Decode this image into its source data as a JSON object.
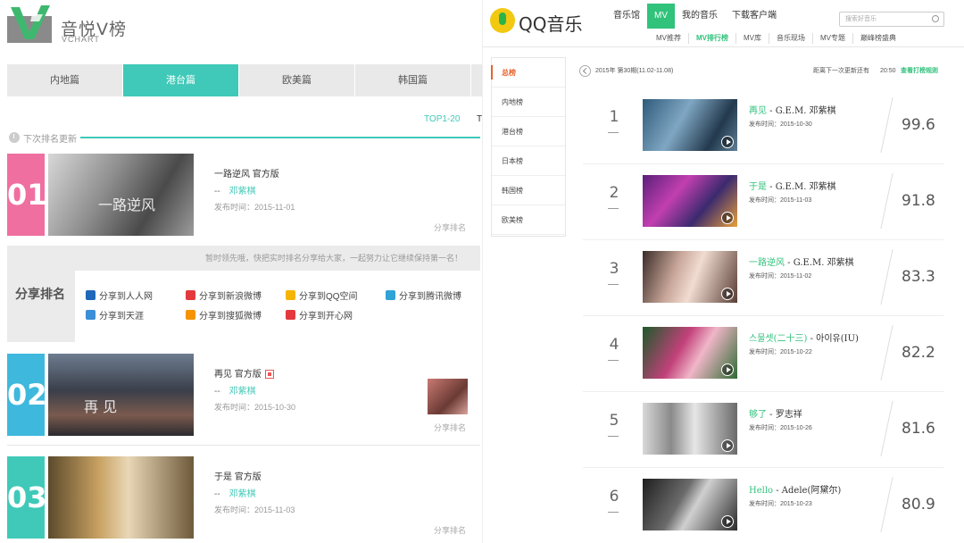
{
  "yinyue": {
    "brand": "音悦V榜",
    "brand_sub": "VCHART",
    "region_tabs": [
      {
        "label": "内地篇",
        "active": false
      },
      {
        "label": "港台篇",
        "active": true
      },
      {
        "label": "欧美篇",
        "active": false
      },
      {
        "label": "韩国篇",
        "active": false
      }
    ],
    "range_active": "TOP1-20",
    "range_other": "T",
    "next_update": "下次排名更新",
    "rows": [
      {
        "rank": "01",
        "color": "#ef6fa0",
        "thumb_text": "一路逆风",
        "title": "一路逆风 官方版",
        "dash": "--",
        "artist": "邓紫棋",
        "date": "发布时间：2015-11-01",
        "share": "分享排名"
      },
      {
        "rank": "02",
        "color": "#3fb8dd",
        "thumb_text": "再  见",
        "title": "再见 官方版",
        "dash": "--",
        "artist": "邓紫棋",
        "date": "发布时间：2015-10-30",
        "share": "分享排名"
      },
      {
        "rank": "03",
        "color": "#40c9b8",
        "thumb_text": "",
        "title": "于是 官方版",
        "dash": "--",
        "artist": "邓紫棋",
        "date": "发布时间：2015-11-03",
        "share": "分享排名"
      }
    ],
    "share_panel": {
      "label": "分享排名",
      "message": "暂时领先哦，快把实时排名分享给大家，一起努力让它继续保持第一名！",
      "items": [
        {
          "label": "分享到人人网",
          "color": "#1f67b8"
        },
        {
          "label": "分享到新浪微博",
          "color": "#e4393c"
        },
        {
          "label": "分享到QQ空间",
          "color": "#f5b400"
        },
        {
          "label": "分享到腾讯微博",
          "color": "#2fa2d6"
        },
        {
          "label": "分享到天涯",
          "color": "#3a8fd6"
        },
        {
          "label": "分享到搜狐微博",
          "color": "#f59300"
        },
        {
          "label": "分享到开心网",
          "color": "#e4393c"
        }
      ]
    }
  },
  "qq": {
    "brand": "QQ音乐",
    "nav": [
      {
        "label": "音乐馆",
        "active": false
      },
      {
        "label": "MV",
        "active": true
      },
      {
        "label": "我的音乐",
        "active": false
      },
      {
        "label": "下载客户端",
        "active": false
      }
    ],
    "search_placeholder": "搜索好音乐",
    "subnav": [
      {
        "label": "MV推荐",
        "active": false
      },
      {
        "label": "MV排行榜",
        "active": true
      },
      {
        "label": "MV库",
        "active": false
      },
      {
        "label": "音乐现场",
        "active": false
      },
      {
        "label": "MV专题",
        "active": false
      },
      {
        "label": "巅峰榜盛典",
        "active": false
      }
    ],
    "side_tabs": [
      {
        "label": "总榜",
        "active": true
      },
      {
        "label": "内地榜",
        "active": false
      },
      {
        "label": "港台榜",
        "active": false
      },
      {
        "label": "日本榜",
        "active": false
      },
      {
        "label": "韩国榜",
        "active": false
      },
      {
        "label": "欧美榜",
        "active": false
      }
    ],
    "period": "2015年 第30期(11.02-11.08)",
    "next_update_label": "距离下一次更新还有",
    "next_update_time": "20:50",
    "rules_link": "查看打榜规则",
    "rows": [
      {
        "rank": "1",
        "song": "再见",
        "artist": " - G.E.M. 邓紫棋",
        "date": "发布时间：2015-10-30",
        "score": "99.6"
      },
      {
        "rank": "2",
        "song": "于是",
        "artist": " - G.E.M. 邓紫棋",
        "date": "发布时间：2015-11-03",
        "score": "91.8"
      },
      {
        "rank": "3",
        "song": "一路逆风",
        "artist": " - G.E.M. 邓紫棋",
        "date": "发布时间：2015-11-02",
        "score": "83.3"
      },
      {
        "rank": "4",
        "song": "스물셋(二十三)",
        "artist": " - 아이유(IU)",
        "date": "发布时间：2015-10-22",
        "score": "82.2"
      },
      {
        "rank": "5",
        "song": "够了",
        "artist": " - 罗志祥",
        "date": "发布时间：2015-10-26",
        "score": "81.6"
      },
      {
        "rank": "6",
        "song": "Hello",
        "artist": " - Adele(阿黛尔)",
        "date": "发布时间：2015-10-23",
        "score": "80.9"
      }
    ]
  }
}
